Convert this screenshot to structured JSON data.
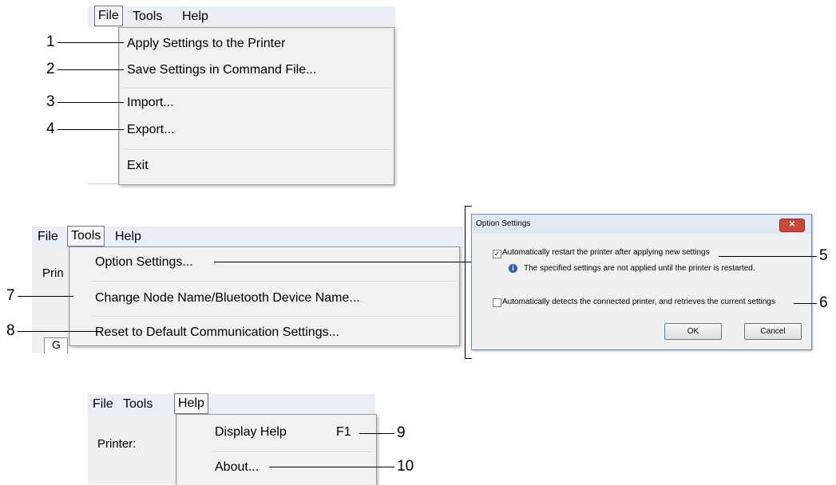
{
  "menu1": {
    "bar": [
      "File",
      "Tools",
      "Help"
    ],
    "items": [
      "Apply Settings to the Printer",
      "Save Settings in Command File...",
      "Import...",
      "Export...",
      "Exit"
    ]
  },
  "menu2": {
    "bar": [
      "File",
      "Tools",
      "Help"
    ],
    "bg_label": "Prin",
    "bg_tab": "G",
    "items": [
      "Option Settings...",
      "Change Node Name/Bluetooth Device Name...",
      "Reset to Default Communication Settings..."
    ]
  },
  "dialog": {
    "title": "Option Settings",
    "close": "✕",
    "option1": "Automatically restart the printer after applying new settings",
    "option1_checked": true,
    "info": "The specified settings are not applied until the printer is restarted.",
    "option2": "Automatically detects the connected printer, and retrieves the current settings",
    "option2_checked": false,
    "ok": "OK",
    "cancel": "Cancel"
  },
  "menu3": {
    "bar": [
      "File",
      "Tools",
      "Help"
    ],
    "bg_label": "Printer:",
    "items": [
      "Display Help",
      "About..."
    ],
    "shortcut": "F1"
  },
  "callouts": [
    "1",
    "2",
    "3",
    "4",
    "5",
    "6",
    "7",
    "8",
    "9",
    "10"
  ]
}
